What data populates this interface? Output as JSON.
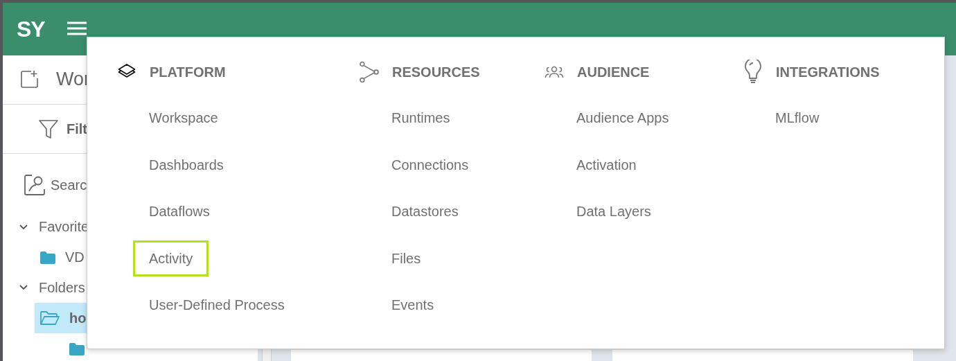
{
  "header": {
    "logo": "SY"
  },
  "sidebar": {
    "title": "Wor",
    "filter": "Filt",
    "search": "Searc",
    "sections": [
      {
        "label": "Favorite",
        "expanded": true,
        "items": [
          {
            "label": "VD",
            "selected": false,
            "open": false
          }
        ]
      },
      {
        "label": "Folders",
        "expanded": true,
        "items": [
          {
            "label": "ho",
            "selected": true,
            "open": true
          }
        ]
      }
    ]
  },
  "menu": {
    "columns": [
      {
        "title": "PLATFORM",
        "items": [
          {
            "label": "Workspace",
            "selected": false
          },
          {
            "label": "Dashboards",
            "selected": false
          },
          {
            "label": "Dataflows",
            "selected": false
          },
          {
            "label": "Activity",
            "selected": true
          },
          {
            "label": "User-Defined Process",
            "selected": false
          }
        ]
      },
      {
        "title": "RESOURCES",
        "items": [
          {
            "label": "Runtimes",
            "selected": false
          },
          {
            "label": "Connections",
            "selected": false
          },
          {
            "label": "Datastores",
            "selected": false
          },
          {
            "label": "Files",
            "selected": false
          },
          {
            "label": "Events",
            "selected": false
          }
        ]
      },
      {
        "title": "AUDIENCE",
        "items": [
          {
            "label": "Audience Apps",
            "selected": false
          },
          {
            "label": "Activation",
            "selected": false
          },
          {
            "label": "Data Layers",
            "selected": false
          }
        ]
      },
      {
        "title": "INTEGRATIONS",
        "items": [
          {
            "label": "MLflow",
            "selected": false
          }
        ]
      }
    ]
  }
}
